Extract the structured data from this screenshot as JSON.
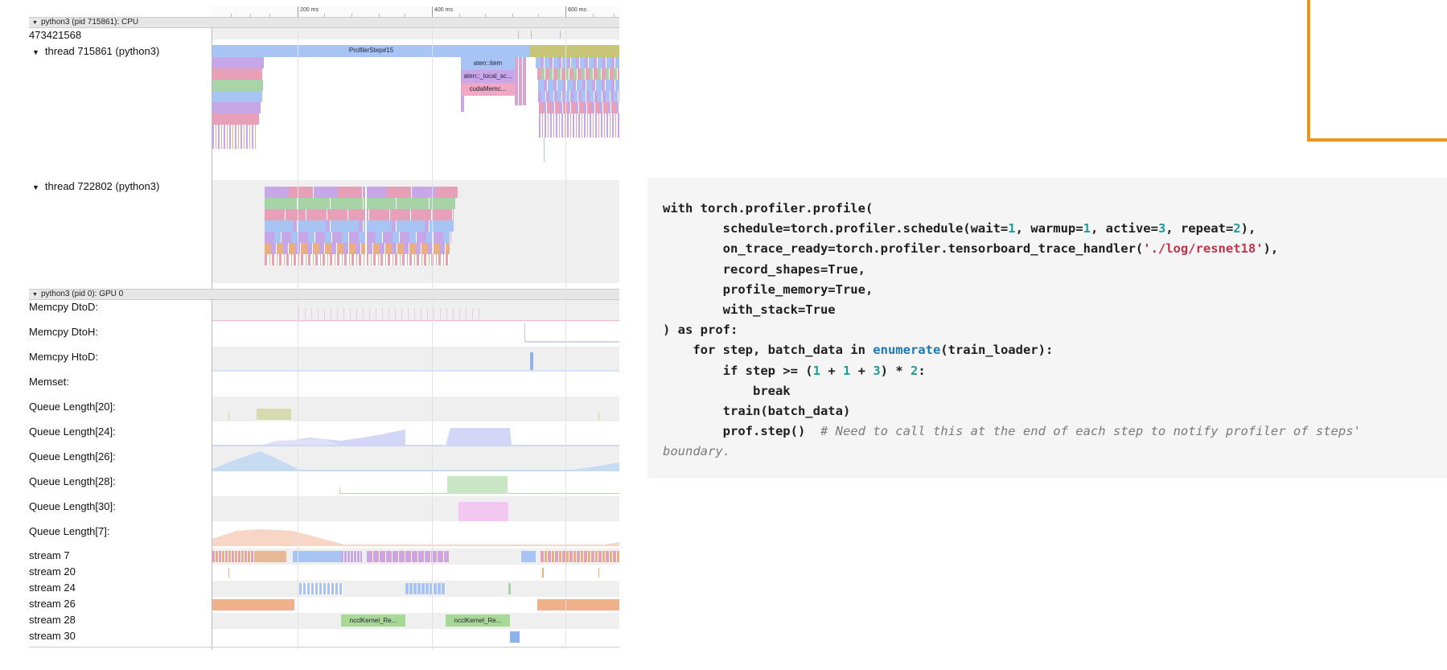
{
  "trace_viewer": {
    "ruler": {
      "ticks": [
        "200 ms",
        "400 ms",
        "600 ms"
      ]
    },
    "cpu_process": {
      "header": "python3 (pid 715861): CPU",
      "counter_value": "473421568",
      "thread_1": {
        "label": "thread 715861 (python3)",
        "slices": [
          "ProfilerStep#15",
          "aten::item",
          "aten::_local_sc...",
          "cudaMemc..."
        ]
      },
      "thread_2": {
        "label": "thread 722802 (python3)"
      }
    },
    "gpu_process": {
      "header": "python3 (pid 0): GPU 0",
      "tracks": [
        "Memcpy DtoD:",
        "Memcpy DtoH:",
        "Memcpy HtoD:",
        "Memset:",
        "Queue Length[20]:",
        "Queue Length[24]:",
        "Queue Length[26]:",
        "Queue Length[28]:",
        "Queue Length[30]:",
        "Queue Length[7]:"
      ],
      "streams": [
        "stream 7",
        "stream 20",
        "stream 24",
        "stream 26",
        "stream 28",
        "stream 30"
      ],
      "kernel_labels": [
        "ncclKernel_Re...",
        "ncclKernel_Re..."
      ]
    }
  },
  "code": {
    "line1": "with torch.profiler.profile(",
    "line2": "        schedule=torch.profiler.schedule(wait=1, warmup=1, active=3, repeat=2),",
    "line3": "        on_trace_ready=torch.profiler.tensorboard_trace_handler('./log/resnet18'),",
    "line4": "        record_shapes=True,",
    "line5": "        profile_memory=True,",
    "line6": "        with_stack=True",
    "line7": ") as prof:",
    "line8": "    for step, batch_data in enumerate(train_loader):",
    "line9": "        if step >= (1 + 1 + 3) * 2:",
    "line10": "            break",
    "line11": "        train(batch_data)",
    "line12": "        prof.step()  # Need to call this at the end of each step to notify profiler of steps'",
    "line13": "boundary."
  },
  "colors": {
    "accent_box": "#f0921e",
    "code_bg": "#f5f5f5",
    "number": "#1e9a9a",
    "string": "#c2334d",
    "builtin": "#1f78b4",
    "comment": "#7a7a7a"
  }
}
